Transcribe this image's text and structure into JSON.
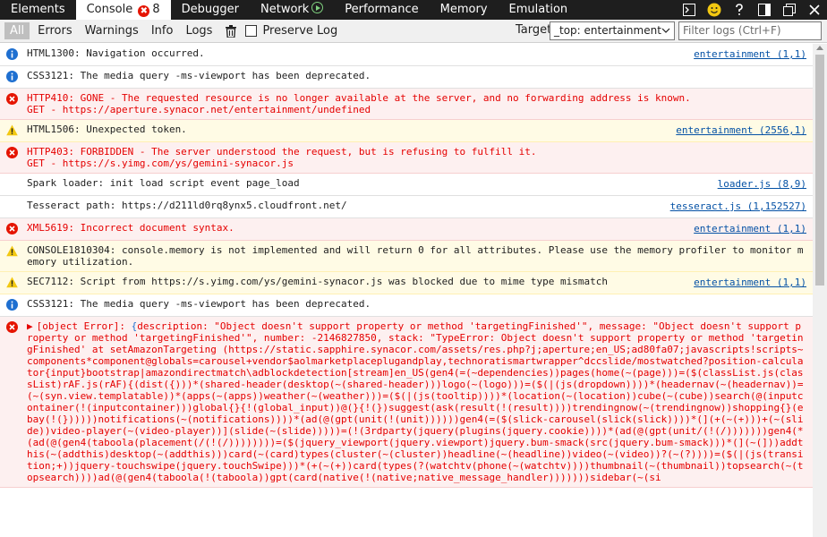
{
  "tabs": [
    {
      "label": "Elements"
    },
    {
      "label": "Console",
      "count": "8",
      "errors": "✖"
    },
    {
      "label": "Debugger"
    },
    {
      "label": "Network"
    },
    {
      "label": "Performance"
    },
    {
      "label": "Memory"
    },
    {
      "label": "Emulation"
    }
  ],
  "window_icons": [
    "console-toggle-icon",
    "smiley-icon",
    "help-icon",
    "dock-icon",
    "restore-icon",
    "close-icon"
  ],
  "filters": {
    "all": "All",
    "errors": "Errors",
    "warnings": "Warnings",
    "info": "Info",
    "logs": "Logs",
    "preserve_log": "Preserve Log",
    "target_label": "Target",
    "target_value": "_top: entertainment",
    "search_placeholder": "Filter logs (Ctrl+F)"
  },
  "colors": {
    "error": "#e50000",
    "warning": "#f2c811",
    "info": "#1e6fd0",
    "link": "#0451a5"
  },
  "messages": [
    {
      "level": "info",
      "text": "HTML1300: Navigation occurred.",
      "source": "entertainment (1,1)"
    },
    {
      "level": "info",
      "text": "CSS3121: The media query -ms-viewport has been deprecated.",
      "source": ""
    },
    {
      "level": "error",
      "text": "HTTP410: GONE - The requested resource is no longer available at the server, and no forwarding address is known.\nGET - https://aperture.synacor.net/entertainment/undefined",
      "source": ""
    },
    {
      "level": "warning",
      "text": "HTML1506: Unexpected token.",
      "source": "entertainment (2556,1)"
    },
    {
      "level": "error",
      "text": "HTTP403: FORBIDDEN - The server understood the request, but is refusing to fulfill it.\nGET - https://s.yimg.com/ys/gemini-synacor.js",
      "source": ""
    },
    {
      "level": "log",
      "text": "Spark loader: init load script event page_load",
      "source": "loader.js (8,9)"
    },
    {
      "level": "log",
      "text": "Tesseract path: https://d211ld0rq8ynx5.cloudfront.net/",
      "source": "tesseract.js (1,152527)"
    },
    {
      "level": "error",
      "text": "XML5619: Incorrect document syntax.",
      "source": "entertainment (1,1)"
    },
    {
      "level": "warning",
      "text": "CONSOLE1810304: console.memory is not implemented and will return 0 for all attributes. Please use the memory profiler to monitor memory utilization.",
      "source": ""
    },
    {
      "level": "warning",
      "text": "SEC7112: Script from https://s.yimg.com/ys/gemini-synacor.js was blocked due to mime type mismatch",
      "source": "entertainment (1,1)"
    },
    {
      "level": "info",
      "text": "CSS3121: The media query -ms-viewport has been deprecated.",
      "source": ""
    }
  ],
  "error_object": {
    "prefix": "[object Error]: ",
    "brace": "{",
    "text": "description: \"Object doesn't support property or method 'targetingFinished'\", message: \"Object doesn't support property or method 'targetingFinished'\", number: -2146827850, stack: \"TypeError: Object doesn't support property or method 'targetingFinished' at setAmazonTargeting (https://static.sapphire.synacor.com/assets/res.php?j;aperture;en_US;ad80fa07;javascripts!scripts~components*component@globals=carousel+vendor$aolmarketplaceplugandplay,technoratismartwrapper^dccslide/mostwatched?position-calculator{input}bootstrap|amazondirectmatch\\adblockdetection[stream]en_US(gen4(=(~dependencies))pages(home(~(page)))=($(classList.js(classList)rAF.js(rAF){(dist({)))*(shared-header(desktop(~(shared-header)))logo(~(logo)))=($(|(js(dropdown))))*(headernav(~(headernav))=(~(syn.view.templatable))*(apps(~(apps))weather(~(weather)))=($(|(js(tooltip))))*(location(~(location))cube(~(cube))search(@(inputcontainer(!(inputcontainer)))global{}{!(global_input))@(}{!(})suggest(ask(result(!(result))))trendingnow(~(trendingnow))shopping{}(ebay(!(})))))notifications(~(notifications))))*(ad(@(gpt(unit(!(unit))))))gen4(=($(slick-carousel(slick(slick))))*(](+(~(+)))+(~(slide))video-player(~(video-player))](slide(~(slide)))))=(!(3rdparty(jquery(plugins(jquery.cookie))))*(ad(@(gpt(unit/(!(/)))))))gen4(*(ad(@(gen4(taboola(placement(/(!(/))))))))=($(jquery_viewport(jquery.viewport)jquery.bum-smack(src(jquery.bum-smack)))*(](~(]))addthis(~(addthis)desktop(~(addthis)))card(~(card)types(cluster(~(cluster))headline(~(headline))video(~(video))?(~(?))))=($(|(js(transition;+))jquery-touchswipe(jquery.touchSwipe)))*(+(~(+))card(types(?(watchtv(phone(~(watchtv))))thumbnail(~(thumbnail))topsearch(~(topsearch))))ad(@(gen4(taboola(!(taboola))gpt(card(native(!(native;native_message_handler)))))))sidebar(~(si"
  }
}
